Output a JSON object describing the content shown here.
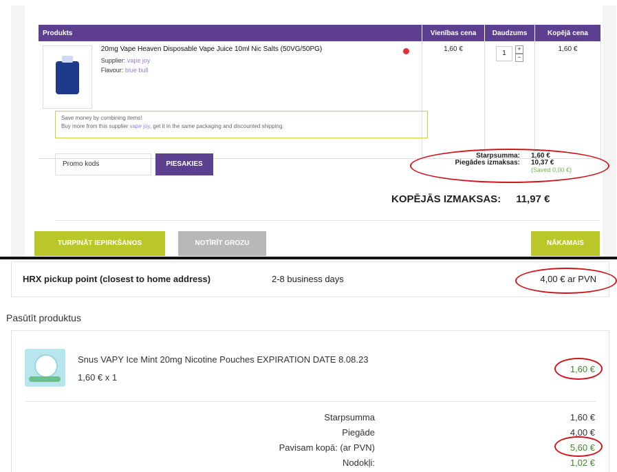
{
  "cart": {
    "headers": {
      "product": "Produkts",
      "unit_price": "Vienības cena",
      "quantity": "Daudzums",
      "total_price": "Kopējā cena"
    },
    "item": {
      "title": "20mg Vape Heaven Disposable Vape Juice 10ml Nic Salts (50VG/50PG)",
      "supplier_label": "Supplier:",
      "supplier_value": "vape joy",
      "flavour_label": "Flavour:",
      "flavour_value": "blue bull",
      "unit_price": "1,60 €",
      "quantity": "1",
      "total_price": "1,60 €"
    },
    "save_box": {
      "line1": "Save money by combining items!",
      "line2_pre": "Buy more from this supplier",
      "line2_link": "vape joy",
      "line2_post": ", get it in the same packaging and discounted shipping."
    },
    "promo": {
      "placeholder": "Promo kods",
      "button": "PIESAKIES"
    },
    "summary": {
      "subtotal_label": "Starpsumma:",
      "subtotal_value": "1,60 €",
      "shipping_label": "Piegādes izmaksas:",
      "shipping_value": "10,37 €",
      "saved": "(Saved 0,00 €)"
    },
    "total": {
      "label": "KOPĒJĀS IZMAKSAS:",
      "value": "11,97 €"
    },
    "buttons": {
      "continue": "TURPINĀT IEPIRKŠANOS",
      "clear": "NOTĪRĪT GROZU",
      "next": "NĀKAMAIS"
    }
  },
  "shipping_option": {
    "name": "HRX pickup point (closest to home address)",
    "days": "2-8 business days",
    "price": "4,00 € ar PVN"
  },
  "order": {
    "section_title": "Pasūtīt produktus",
    "item": {
      "title": "Snus VAPY Ice Mint 20mg Nicotine Pouches EXPIRATION DATE 8.08.23",
      "qty": "1,60 € x 1",
      "price": "1,60 €"
    },
    "totals": [
      {
        "label": "Starpsumma",
        "value": "1,60 €",
        "green": false
      },
      {
        "label": "Piegāde",
        "value": "4,00 €",
        "green": false
      },
      {
        "label": "Pavisam kopā: (ar PVN)",
        "value": "5,60 €",
        "green": true
      },
      {
        "label": "Nodokļi:",
        "value": "1,02 €",
        "green": true
      }
    ]
  },
  "colors": {
    "header_purple": "#5c3f8e",
    "button_green": "#b9c72a",
    "button_gray": "#b8b8b8",
    "annotation_red": "#d0141b",
    "price_green": "#3a8a2a"
  }
}
